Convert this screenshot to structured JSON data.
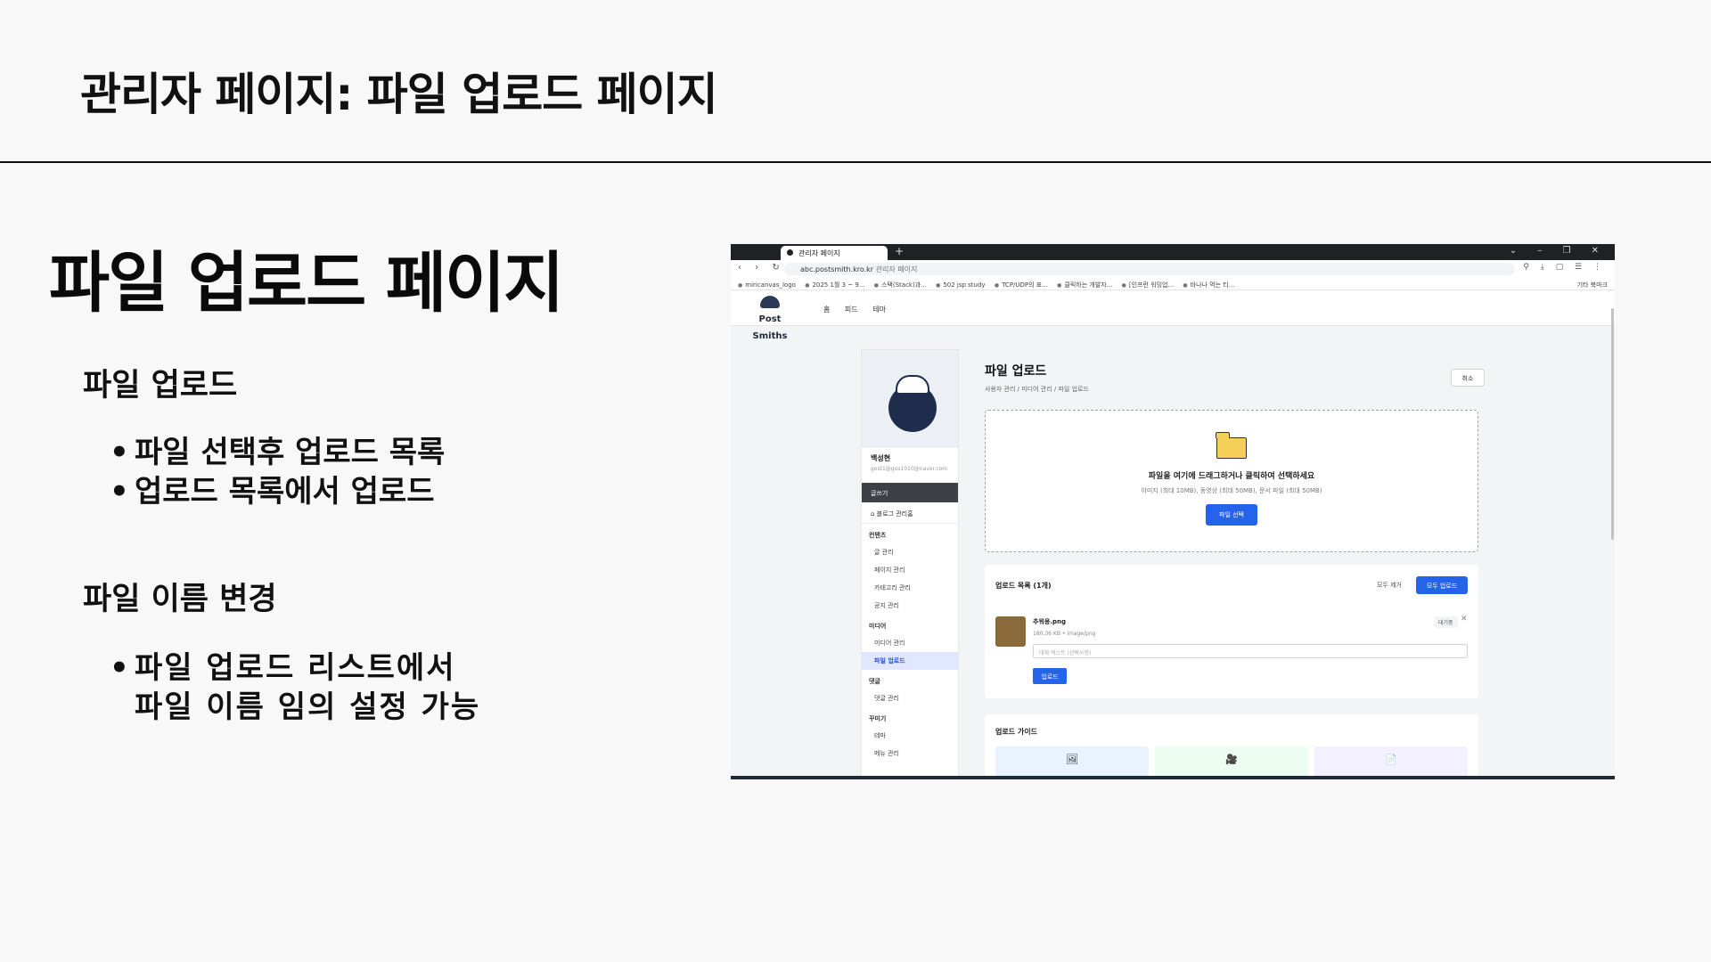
{
  "slide": {
    "title": "관리자 페이지: 파일 업로드 페이지",
    "heading": "파일 업로드 페이지",
    "sections": [
      {
        "title": "파일 업로드",
        "bullets": [
          "파일 선택후 업로드 목록",
          "업로드 목록에서 업로드"
        ]
      },
      {
        "title": "파일 이름 변경",
        "bullets": [
          "파일 업로드 리스트에서 파일 이름 임의 설정 가능"
        ]
      }
    ]
  },
  "browser": {
    "tab_title": "관리자 페이지",
    "url_domain": "abc.postsmith.kro.kr",
    "url_page": "관리자 페이지",
    "bookmarks": [
      "miricanvas_logo",
      "2025 1월 3 ~ 9...",
      "스택(Stack)과...",
      "502 jsp study",
      "TCP/UDP의 표...",
      "클릭하는 개발자...",
      "[인프런 워밍업...",
      "바나나 먹는 티..."
    ],
    "bookmark_folder": "기타 북마크"
  },
  "site": {
    "logo": "Post Smiths",
    "nav": [
      "홈",
      "피드",
      "테마"
    ]
  },
  "sidebar": {
    "user_name": "백성현",
    "user_email": "gost1@gus1010@naver.com",
    "write_label": "글쓰기",
    "blog_home": "블로그 관리홈",
    "groups": [
      {
        "label": "컨텐츠",
        "items": [
          "글 관리",
          "페이지 관리",
          "카테고리 관리",
          "공지 관리"
        ]
      },
      {
        "label": "미디어",
        "items": [
          "미디어 관리",
          "파일 업로드"
        ]
      },
      {
        "label": "댓글",
        "items": [
          "댓글 관리"
        ]
      },
      {
        "label": "꾸미기",
        "items": [
          "테마",
          "메뉴 관리"
        ]
      }
    ],
    "active_item": "파일 업로드"
  },
  "upload_page": {
    "title": "파일 업로드",
    "breadcrumb": "사용자 관리 / 미디어 관리 / 파일 업로드",
    "cancel_label": "취소",
    "drop_title": "파일을 여기에 드래그하거나 클릭하여 선택하세요",
    "drop_sub": "이미지 (최대 10MB), 동영상 (최대 50MB), 문서 파일 (최대 50MB)",
    "select_label": "파일 선택",
    "list_title": "업로드 목록 (1개)",
    "clear_label": "모두 제거",
    "upload_all_label": "모두 업로드",
    "file": {
      "name": "추워용.png",
      "meta": "180.36 KB • image/png",
      "status": "대기중",
      "alt_placeholder": "대체 텍스트 (선택사항)",
      "upload_label": "업로드"
    },
    "guide_title": "업로드 가이드"
  },
  "icons": {
    "folder": "folder-icon",
    "image": "🖼",
    "video": "🎥",
    "document": "📄"
  },
  "colors": {
    "accent": "#2563eb",
    "dark": "#3f3f46"
  }
}
